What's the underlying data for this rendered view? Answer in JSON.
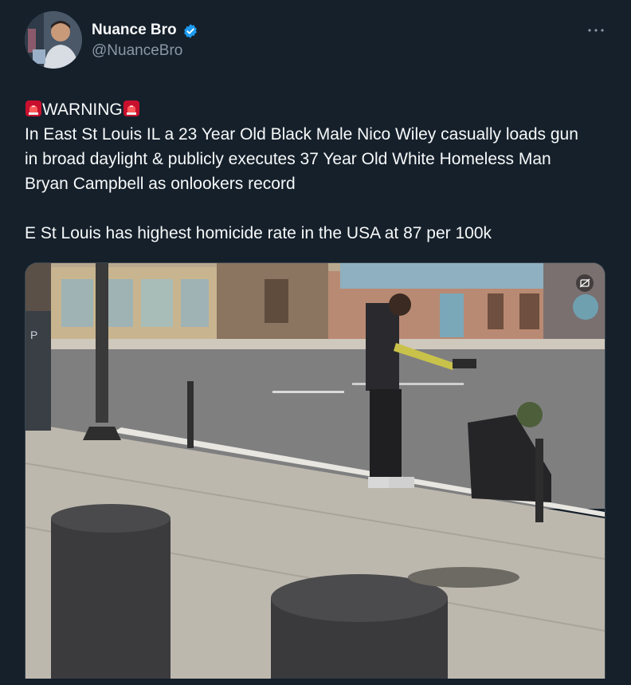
{
  "author": {
    "display_name": "Nuance Bro",
    "handle": "@NuanceBro",
    "verified": true,
    "avatar_icon": "person-avatar"
  },
  "tweet": {
    "warning_label": "WARNING",
    "line1": "In East St Louis IL a 23 Year Old Black Male Nico Wiley casually loads gun",
    "line2": "in broad daylight & publicly executes 37 Year Old White Homeless Man",
    "line3": "Bryan Campbell as onlookers record",
    "line4": "E St Louis has highest homicide rate in the USA at 87 per 100k"
  },
  "media": {
    "type": "video-still",
    "sign_letter": "P"
  },
  "colors": {
    "background": "#15202b",
    "text_primary": "#f7f9f9",
    "text_secondary": "#8b98a5",
    "verified_blue": "#1d9bf0",
    "siren_red": "#e0245e"
  }
}
